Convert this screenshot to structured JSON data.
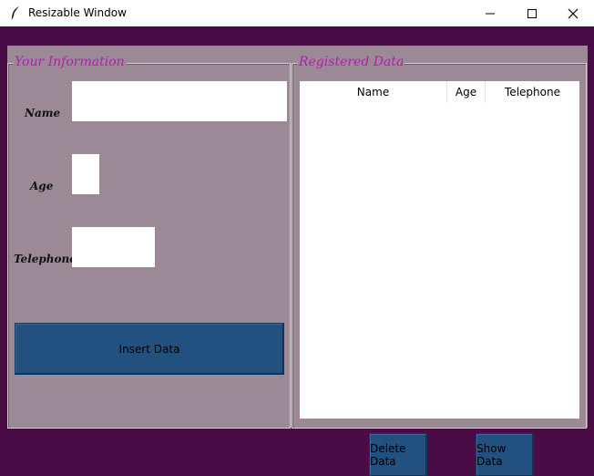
{
  "window": {
    "title": "Resizable Window"
  },
  "info_frame": {
    "title": "Your Information",
    "name_label": "Name",
    "age_label": "Age",
    "telephone_label": "Telephone",
    "name_value": "",
    "age_value": "",
    "telephone_value": "",
    "insert_button": "Insert Data"
  },
  "data_frame": {
    "title": "Registered Data",
    "columns": [
      "Name",
      "Age",
      "Telephone"
    ],
    "rows": []
  },
  "actions": {
    "delete_button": "Delete Data",
    "show_button": "Show Data"
  },
  "colors": {
    "background": "#4a0c46",
    "panel": "#9c8996",
    "frame_title": "#b21fb2",
    "button": "#22507f"
  }
}
